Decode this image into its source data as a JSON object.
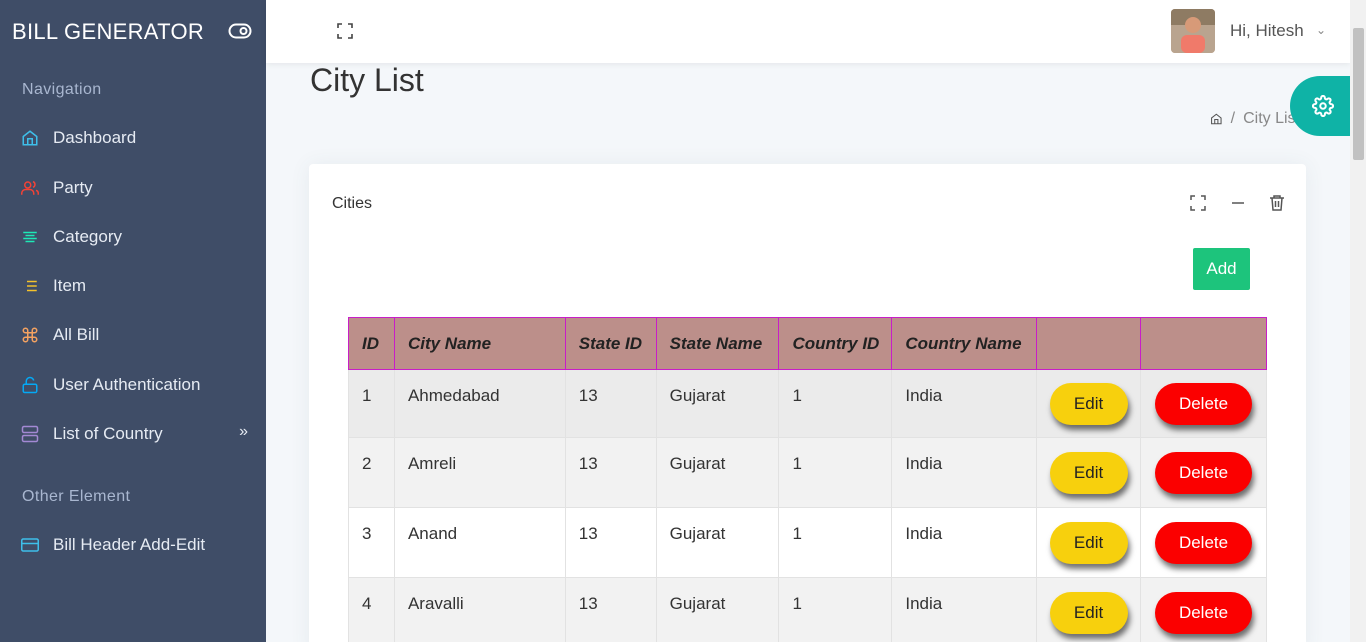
{
  "app": {
    "brand_title": "BILL GENERATOR"
  },
  "sidebar": {
    "caption_navigation": "Navigation",
    "caption_other": "Other Element",
    "items": [
      {
        "label": "Dashboard",
        "icon": "home-icon",
        "color": "#3ebfea"
      },
      {
        "label": "Party",
        "icon": "users-icon",
        "color": "#f44236"
      },
      {
        "label": "Category",
        "icon": "align-center-icon",
        "color": "#1de9b6"
      },
      {
        "label": "Item",
        "icon": "list-icon",
        "color": "#f4c22b"
      },
      {
        "label": "All Bill",
        "icon": "command-icon",
        "color": "#f4a261"
      },
      {
        "label": "User Authentication",
        "icon": "unlock-icon",
        "color": "#04a9f5"
      },
      {
        "label": "List of Country",
        "icon": "server-icon",
        "color": "#a389d4"
      },
      {
        "label": "Bill Header Add-Edit",
        "icon": "credit-card-icon",
        "color": "#3ebfea"
      }
    ]
  },
  "header": {
    "greeting": "Hi, Hitesh"
  },
  "page": {
    "title": "City List",
    "breadcrumb_current": "City List"
  },
  "card": {
    "title": "Cities",
    "add_label": "Add"
  },
  "table": {
    "columns": [
      "ID",
      "City Name",
      "State ID",
      "State Name",
      "Country ID",
      "Country Name",
      "",
      ""
    ],
    "rows": [
      {
        "id": "1",
        "city": "Ahmedabad",
        "state_id": "13",
        "state": "Gujarat",
        "country_id": "1",
        "country": "India"
      },
      {
        "id": "2",
        "city": "Amreli",
        "state_id": "13",
        "state": "Gujarat",
        "country_id": "1",
        "country": "India"
      },
      {
        "id": "3",
        "city": "Anand",
        "state_id": "13",
        "state": "Gujarat",
        "country_id": "1",
        "country": "India"
      },
      {
        "id": "4",
        "city": "Aravalli",
        "state_id": "13",
        "state": "Gujarat",
        "country_id": "1",
        "country": "India"
      }
    ],
    "edit_label": "Edit",
    "delete_label": "Delete"
  },
  "colors": {
    "sidebar_bg": "#3f4d67",
    "add_button": "#1dc47c",
    "edit_button": "#f7d00d",
    "delete_button": "#fb0000",
    "table_header": "#bc8f8a",
    "settings_fab": "#0fb3a6"
  }
}
